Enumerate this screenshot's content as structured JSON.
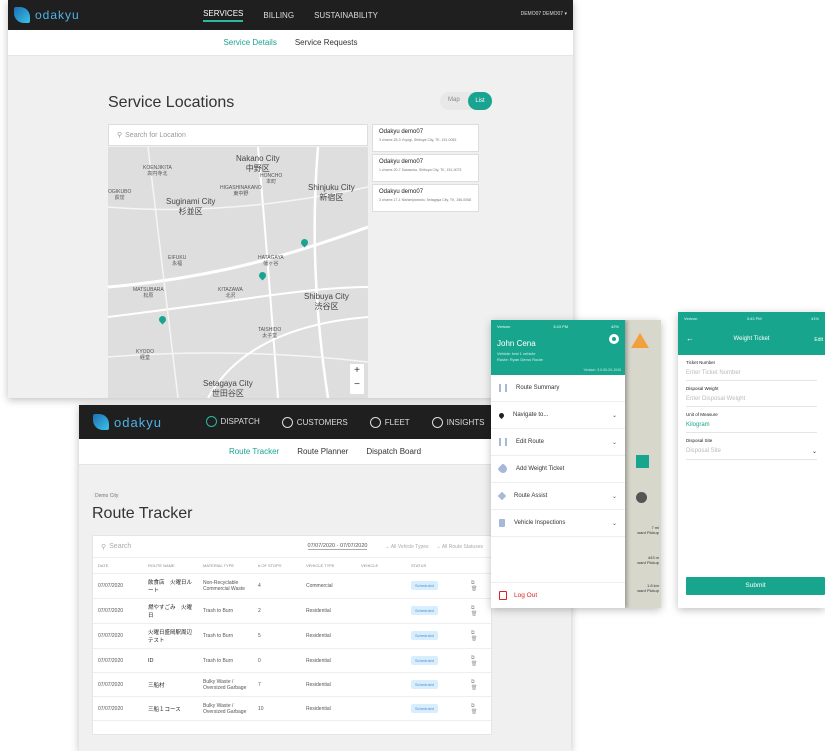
{
  "services": {
    "logo": "odakyu",
    "nav": [
      "SERVICES",
      "BILLING",
      "SUSTAINABILITY"
    ],
    "user": "DEMO07 DEMO07",
    "subnav": [
      "Service Details",
      "Service Requests"
    ],
    "heading": "Service Locations",
    "toggle": {
      "map": "Map",
      "list": "List"
    },
    "search_placeholder": "Search for Location",
    "map_labels": {
      "nakano": "Nakano City\n中野区",
      "suginami": "Suginami City\n杉並区",
      "shinjuku": "Shinjuku City\n新宿区",
      "shibuya": "Shibuya City\n渋谷区",
      "setagaya": "Setagaya City\n世田谷区",
      "koenji": "KOENJIKITA\n高円寺北",
      "higashi": "HIGASHINAKANO\n東中野",
      "ogikubo": "OGIKUBO\n荻窪",
      "honcho": "HONCHO\n本町",
      "eifuku": "EIFUKU\n永福",
      "shimokita": "KITAZAWA\n北沢",
      "kyodo": "KYODO\n経堂",
      "mitaka": "MATSUBARA\n松原",
      "hatagaya": "HATAGAYA\n幡ヶ谷",
      "sangenjaya": "TAISHIDO\n太子堂"
    },
    "locations": [
      {
        "name": "Odakyu demo07",
        "addr": "3 chome-25-3 Yoyogi, Shibuya City, TK, 151-0053"
      },
      {
        "name": "Odakyu demo07",
        "addr": "1 chome-20-7 Sasazuka, Shibuya City, TK, 151-0073"
      },
      {
        "name": "Odakyu demo07",
        "addr": "3 chome-17-1 Nishimiyamoto, Setagaya City, TK, 156-0068"
      }
    ]
  },
  "dispatch": {
    "logo": "odakyu",
    "nav": [
      "DISPATCH",
      "CUSTOMERS",
      "FLEET",
      "INSIGHTS"
    ],
    "subnav": [
      "Route Tracker",
      "Route Planner",
      "Dispatch Board"
    ],
    "zone": "Demo City",
    "title": "Route Tracker",
    "search": "Search",
    "date_range": "07/07/2020 - 07/07/2020",
    "vehicle_filter": "All Vehicle Types",
    "status_filter": "All Route Statuses",
    "columns": [
      "DATE",
      "ROUTE NAME",
      "MATERIAL TYPE",
      "# OF STOPS",
      "VEHICLE TYPE",
      "VEHICLE",
      "STATUS",
      ""
    ],
    "rows": [
      {
        "date": "07/07/2020",
        "route": "飲食店　火曜日ルート",
        "material": "Non-Recyclable Commercial Waste",
        "stops": "4",
        "vehicle_type": "Commercial",
        "vehicle": "",
        "status": "Scheduled"
      },
      {
        "date": "07/07/2020",
        "route": "燃やすごみ　火曜日",
        "material": "Trash to Burn",
        "stops": "2",
        "vehicle_type": "Residential",
        "vehicle": "",
        "status": "Scheduled"
      },
      {
        "date": "07/07/2020",
        "route": "火曜日盛岡駅周辺テスト",
        "material": "Trash to Burn",
        "stops": "5",
        "vehicle_type": "Residential",
        "vehicle": "",
        "status": "Scheduled"
      },
      {
        "date": "07/07/2020",
        "route": "ID",
        "material": "Trash to Burn",
        "stops": "0",
        "vehicle_type": "Residential",
        "vehicle": "",
        "status": "Scheduled"
      },
      {
        "date": "07/07/2020",
        "route": "三船村",
        "material": "Bulky Waste / Oversized Garbage",
        "stops": "7",
        "vehicle_type": "Residential",
        "vehicle": "",
        "status": "Scheduled"
      },
      {
        "date": "07/07/2020",
        "route": "三船１コース",
        "material": "Bulky Waste / Oversized Garbage",
        "stops": "10",
        "vehicle_type": "Residential",
        "vehicle": "",
        "status": "Scheduled"
      }
    ]
  },
  "drawer": {
    "status_left": "Verizon",
    "status_time": "3:43 PM",
    "status_right": "42%",
    "driver": "John Cena",
    "vehicle": "Vehicle: test 1 vehicle",
    "route": "Route: Ryan Demo Route",
    "version": "Version: 3.0.60-20-1043",
    "items": [
      "Route Summary",
      "Navigate to...",
      "Edit Route",
      "Add Weight Ticket",
      "Route Assist",
      "Vehicle Inspections"
    ],
    "logout": "Log Out",
    "bg_info": [
      {
        "dist": "7 mi",
        "label": "ward Pickup"
      },
      {
        "dist": "443 m",
        "label": "ward Pickup"
      },
      {
        "dist": "1.8 km",
        "label": "ward Pickup"
      }
    ]
  },
  "weight_ticket": {
    "status_left": "Verizon",
    "status_time": "3:43 PM",
    "status_right": "41%",
    "title": "Weight Ticket",
    "edit": "Edit",
    "fields": [
      {
        "label": "Ticket Number",
        "placeholder": "Enter Ticket Number"
      },
      {
        "label": "Disposal Weight",
        "placeholder": "Enter Disposal Weight"
      },
      {
        "label": "Unit of Measure",
        "value": "Kilogram"
      },
      {
        "label": "Disposal Site",
        "placeholder": "Disposal Site"
      }
    ],
    "submit": "Submit"
  },
  "colors": {
    "accent": "#19a491",
    "nav_dark": "#1f1f1f",
    "logout": "#e02020",
    "warning": "#f2a03d"
  }
}
